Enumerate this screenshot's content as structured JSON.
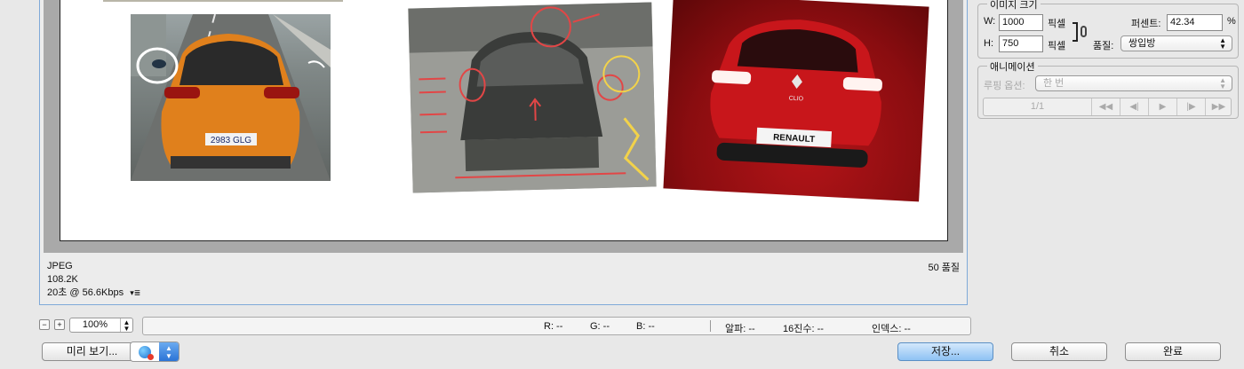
{
  "preview": {
    "format": "JPEG",
    "filesize": "108.2K",
    "download_time": "20초 @ 56.6Kbps",
    "quality_label": "50 품질",
    "plate_text": "2983 GLG",
    "badge_text": "RENAULT",
    "model_text": "CLIO"
  },
  "statusbar": {
    "zoom": "100%",
    "r": "R: --",
    "g": "G: --",
    "b": "B: --",
    "alpha": "알파: --",
    "hex": "16진수: --",
    "index": "인덱스: --"
  },
  "buttons": {
    "preview": "미리 보기...",
    "save": "저장...",
    "cancel": "취소",
    "done": "완료"
  },
  "image_size": {
    "title": "이미지 크기",
    "w_label": "W:",
    "w_value": "1000",
    "h_label": "H:",
    "h_value": "750",
    "unit": "픽셀",
    "percent_label": "퍼센트:",
    "percent_value": "42.34",
    "percent_sign": "%",
    "quality_label": "품질:",
    "quality_value": "쌍입방"
  },
  "animation": {
    "title": "애니메이션",
    "loop_label": "루핑 옵션:",
    "loop_value": "한 번",
    "frame_counter": "1/1"
  },
  "colors": {
    "accent": "#7fa9d8",
    "primary_button": "#8ec2f4"
  }
}
